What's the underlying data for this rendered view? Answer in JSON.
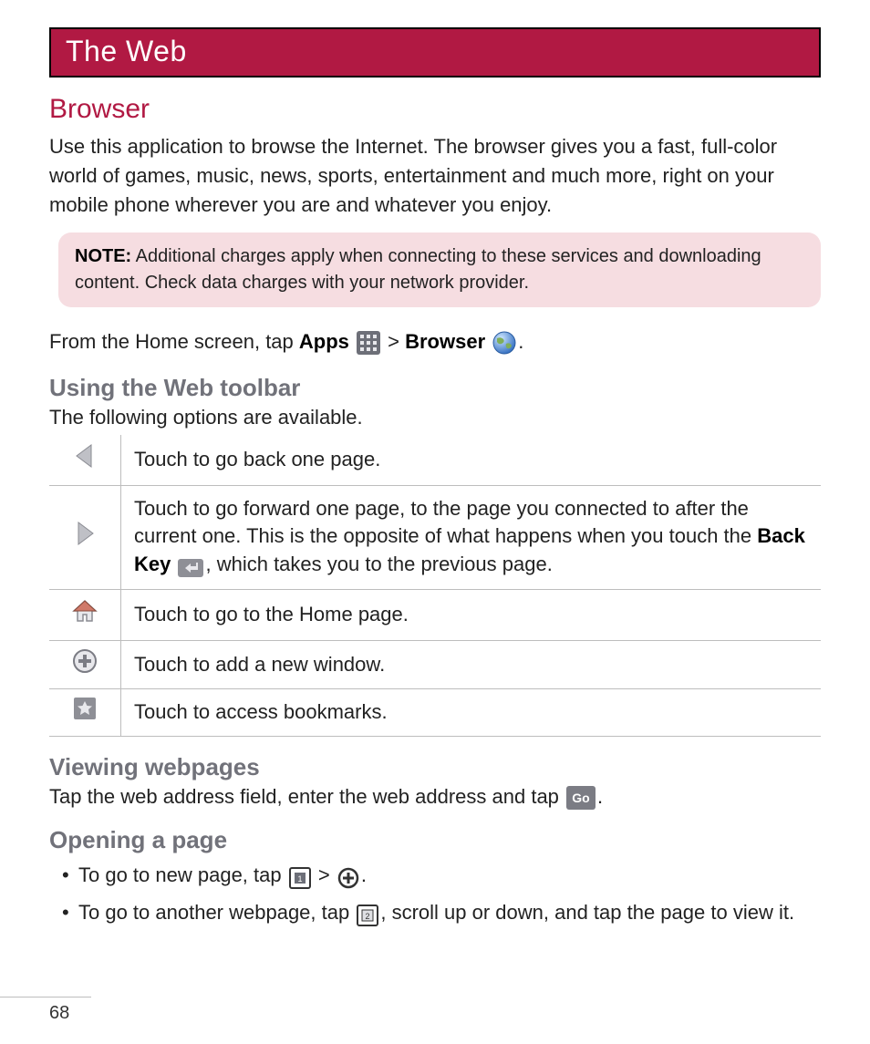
{
  "page_number": "68",
  "header_title": "The Web",
  "section_browser": {
    "title": "Browser",
    "intro": "Use this application to browse the Internet. The browser gives you a fast, full-color world of games, music, news, sports, entertainment and much more, right on your mobile phone wherever you are and whatever you enjoy.",
    "note_label": "NOTE:",
    "note_text": " Additional charges apply when connecting to these services and downloading content. Check data charges with your network provider.",
    "from_pre": "From the Home screen, tap ",
    "from_apps": "Apps",
    "from_mid": " > ",
    "from_browser": "Browser",
    "from_end": "."
  },
  "section_toolbar": {
    "title": "Using the Web toolbar",
    "intro": "The following options are available.",
    "rows": [
      {
        "desc_pre": "Touch to go back one page.",
        "bold": "",
        "desc_post": ""
      },
      {
        "desc_pre": "Touch to go forward one page, to the page you connected to after the current one. This is the opposite of what happens when you touch the ",
        "bold": "Back Key",
        "desc_post": ", which takes you to the previous page."
      },
      {
        "desc_pre": "Touch to go to the Home page.",
        "bold": "",
        "desc_post": ""
      },
      {
        "desc_pre": "Touch to add a new window.",
        "bold": "",
        "desc_post": ""
      },
      {
        "desc_pre": " Touch to access bookmarks.",
        "bold": "",
        "desc_post": ""
      }
    ]
  },
  "section_viewing": {
    "title": "Viewing webpages",
    "pre": "Tap the web address field, enter the web address and tap ",
    "go": "Go",
    "post": "."
  },
  "section_opening": {
    "title": "Opening a page",
    "item1_pre": "To go to new page, tap ",
    "item1_mid": " > ",
    "item1_end": ".",
    "item2_pre": "To go to another webpage, tap ",
    "item2_post": ", scroll up or down, and tap the page to view it."
  }
}
